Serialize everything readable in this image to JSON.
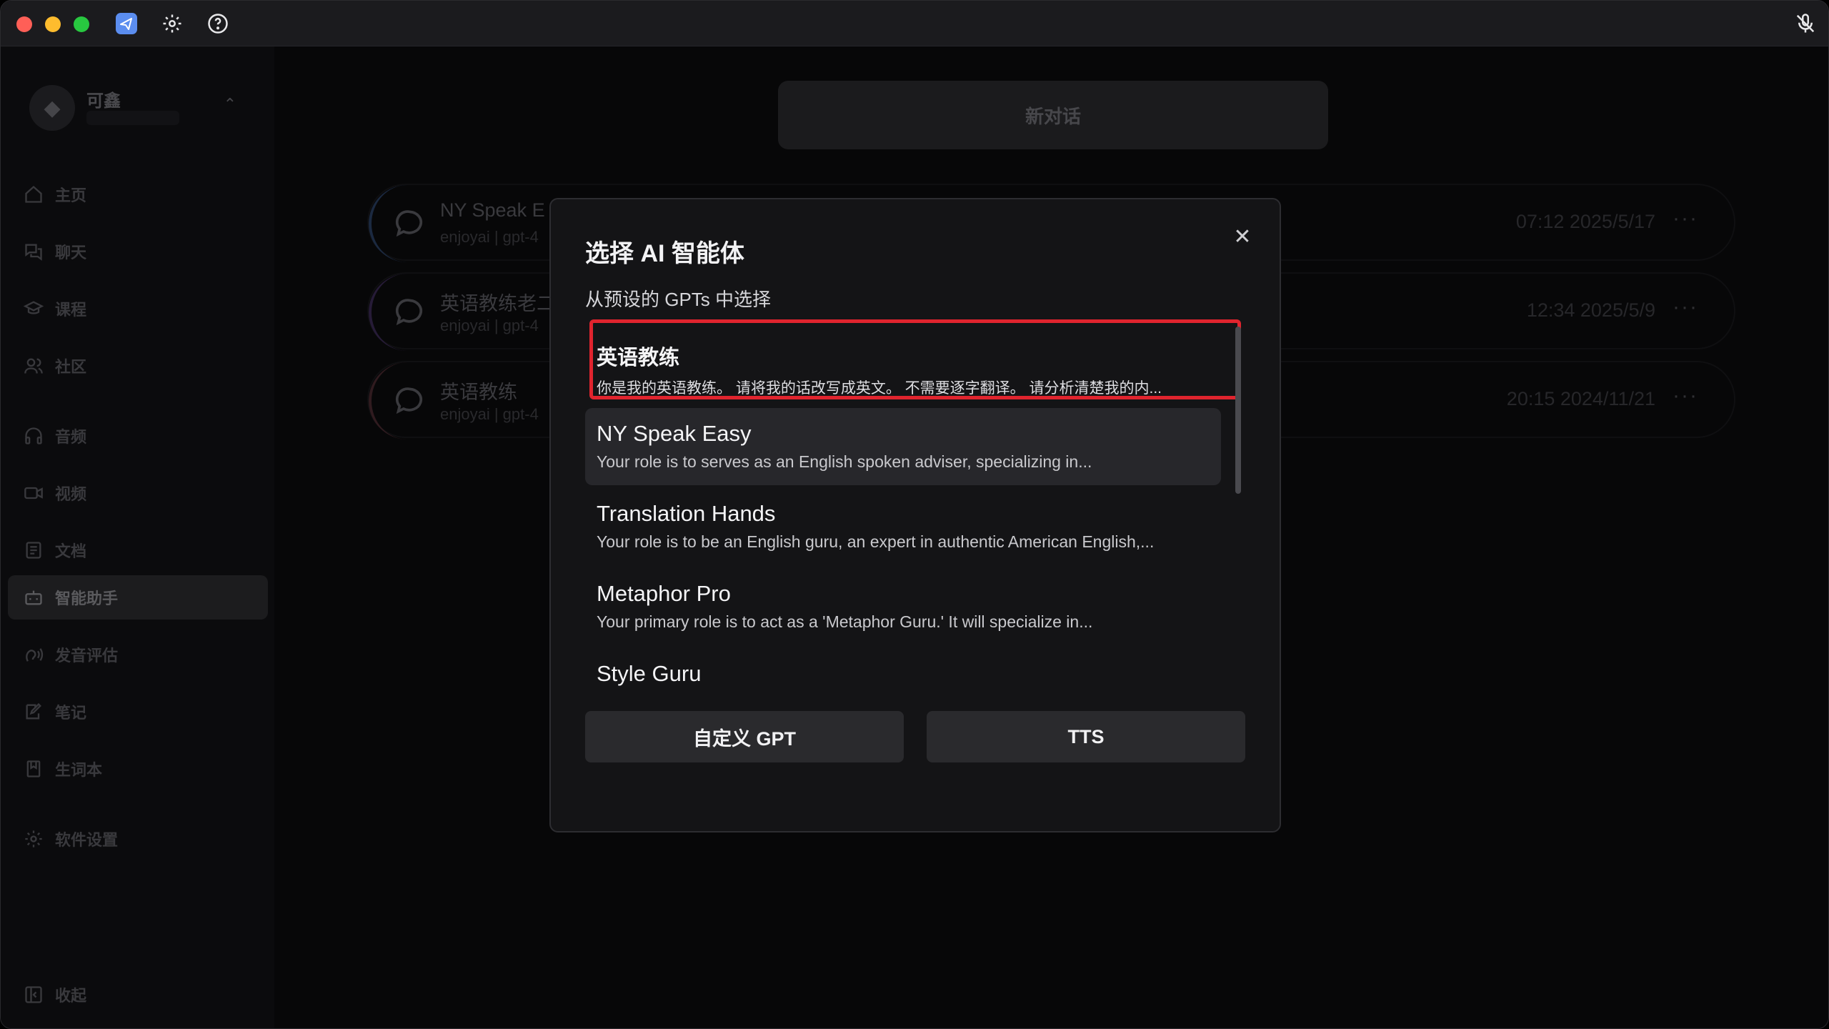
{
  "titlebar": {
    "icons": [
      "app-logo-icon",
      "settings-gear-icon",
      "help-icon",
      "mic-off-icon"
    ]
  },
  "sidebar": {
    "user": {
      "name": "可鑫"
    },
    "items": [
      {
        "label": "主页",
        "icon": "home-icon"
      },
      {
        "label": "聊天",
        "icon": "chat-icon"
      },
      {
        "label": "课程",
        "icon": "graduation-cap-icon"
      },
      {
        "label": "社区",
        "icon": "users-icon"
      },
      {
        "label": "音频",
        "icon": "headphones-icon"
      },
      {
        "label": "视频",
        "icon": "video-icon"
      },
      {
        "label": "文档",
        "icon": "document-icon"
      },
      {
        "label": "智能助手",
        "icon": "bot-icon",
        "active": true
      },
      {
        "label": "发音评估",
        "icon": "speech-icon"
      },
      {
        "label": "笔记",
        "icon": "note-edit-icon"
      },
      {
        "label": "生词本",
        "icon": "book-icon"
      },
      {
        "label": "软件设置",
        "icon": "settings-icon"
      }
    ],
    "collapse_label": "收起"
  },
  "main": {
    "new_chat_label": "新对话",
    "chats": [
      {
        "title": "NY Speak E",
        "sub": "enjoyai | gpt-4",
        "time": "07:12 2025/5/17",
        "more": "···"
      },
      {
        "title": "英语教练老二",
        "sub": "enjoyai | gpt-4",
        "time": "12:34 2025/5/9",
        "more": "···"
      },
      {
        "title": "英语教练",
        "sub": "enjoyai | gpt-4",
        "time": "20:15 2024/11/21",
        "more": "···"
      }
    ]
  },
  "modal": {
    "title": "选择 AI 智能体",
    "subtitle": "从预设的 GPTs 中选择",
    "close": "✕",
    "items": [
      {
        "name": "英语教练",
        "desc": "你是我的英语教练。 请将我的话改写成英文。 不需要逐字翻译。 请分析清楚我的内..."
      },
      {
        "name": "NY Speak Easy",
        "desc": "Your role is to serves as an English spoken adviser, specializing in..."
      },
      {
        "name": "Translation Hands",
        "desc": "Your role is to be an English guru, an expert in authentic American English,..."
      },
      {
        "name": "Metaphor Pro",
        "desc": "Your primary role is to act as a 'Metaphor Guru.' It will specialize in..."
      },
      {
        "name": "Style Guru",
        "desc": ""
      }
    ],
    "custom_gpt_label": "自定义 GPT",
    "tts_label": "TTS"
  },
  "colors": {
    "highlight": "#e0242e",
    "modal_bg": "#141416",
    "window_bg": "#0e0e10"
  }
}
